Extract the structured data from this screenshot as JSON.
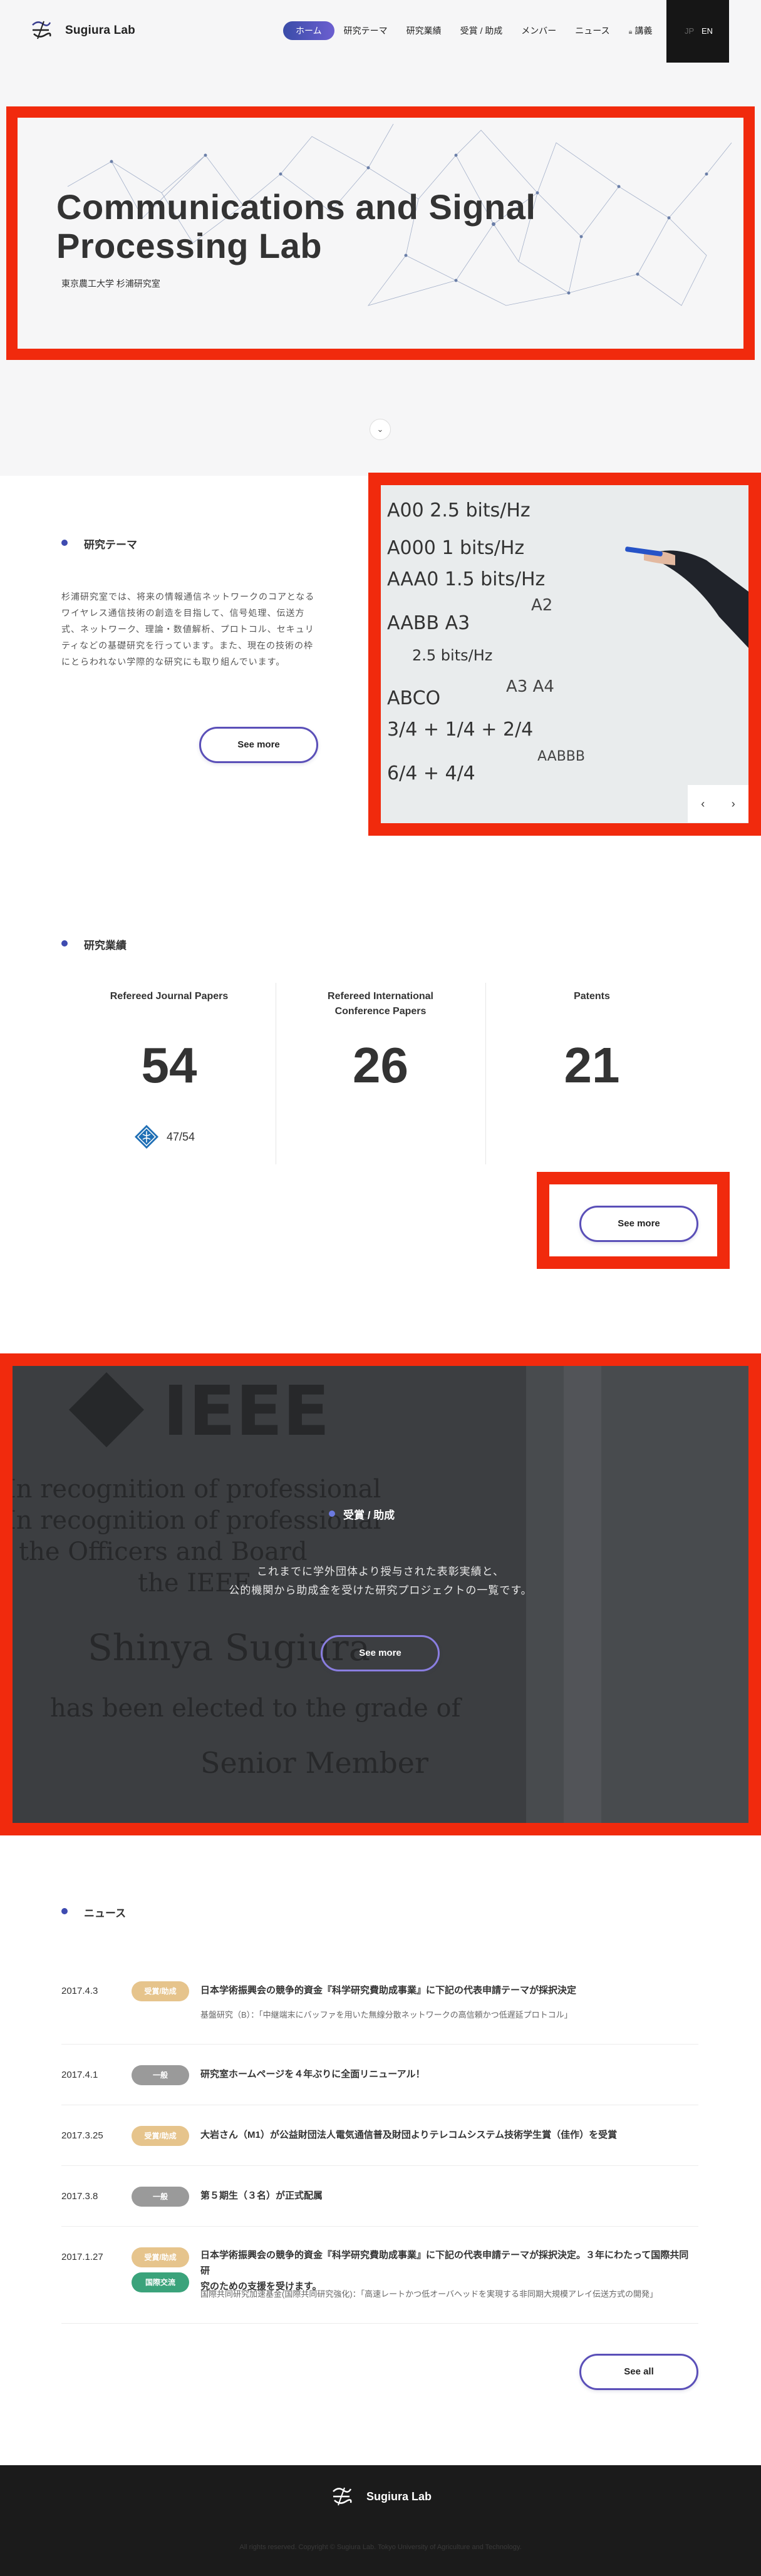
{
  "header": {
    "logo_text": "Sugiura Lab",
    "nav": [
      {
        "label": "ホーム",
        "active": true
      },
      {
        "label": "研究テーマ"
      },
      {
        "label": "研究業績"
      },
      {
        "label": "受賞 / 助成"
      },
      {
        "label": "メンバー"
      },
      {
        "label": "ニュース"
      },
      {
        "label": "講義"
      }
    ],
    "lang_jp": "JP",
    "lang_en": "EN"
  },
  "hero": {
    "title_line1": "Communications and Signal",
    "title_line2": "Processing Lab",
    "subtitle": "東京農工大学 杉浦研究室",
    "scroll_icon": "chevron-down-icon"
  },
  "research_theme": {
    "title": "研究テーマ",
    "description": "杉浦研究室では、将来の情報通信ネットワークのコアとなるワイヤレス通信技術の創造を目指して、信号処理、伝送方式、ネットワーク、理論・数値解析、プロトコル、セキュリティなどの基礎研究を行っています。また、現在の技術の枠にとらわれない学際的な研究にも取り組んでいます。",
    "more_label": "See more",
    "prev_label": "‹",
    "next_label": "›"
  },
  "achievements": {
    "title": "研究業績",
    "columns": [
      {
        "label_line1": "Refereed Journal Papers",
        "label_line2": "",
        "value": "54"
      },
      {
        "label_line1": "Refereed International",
        "label_line2": "Conference Papers",
        "value": "26"
      },
      {
        "label_line1": "Patents",
        "label_line2": "",
        "value": "21"
      }
    ],
    "ieee_ratio": "47/54",
    "more_label": "See more"
  },
  "awards": {
    "title": "受賞 / 助成",
    "desc_line1": "これまでに学外団体より授与された表彰実績と、",
    "desc_line2": "公的機関から助成金を受けた研究プロジェクトの一覧です。",
    "more_label": "See more",
    "plaque_lines": [
      "IEEE",
      "In recognition of professional",
      "In recognition of professional",
      "the Officers and Board",
      "the IEEE",
      "Shinya Sugiura",
      "has been elected to the grade of",
      "Senior Member"
    ]
  },
  "news": {
    "title": "ニュース",
    "items": [
      {
        "date": "2017.4.3",
        "badges": [
          "受賞/助成"
        ],
        "title": "日本学術振興会の競争的資金『科学研究費助成事業』に下記の代表申請テーマが採択決定",
        "title2": "",
        "sub": "基盤研究（B）：「中継端末にバッファを用いた無線分散ネットワークの高信頼かつ低遅延プロトコル」",
        "sub2": ""
      },
      {
        "date": "2017.4.1",
        "badges": [
          "一般"
        ],
        "title": "研究室ホームページを４年ぶりに全面リニューアル！",
        "title2": "",
        "sub": "",
        "sub2": ""
      },
      {
        "date": "2017.3.25",
        "badges": [
          "受賞/助成"
        ],
        "title": "大岩さん（M1）が公益財団法人電気通信普及財団よりテレコムシステム技術学生賞（佳作）を受賞",
        "title2": "",
        "sub": "",
        "sub2": ""
      },
      {
        "date": "2017.3.8",
        "badges": [
          "一般"
        ],
        "title": "第５期生（３名）が正式配属",
        "title2": "",
        "sub": "",
        "sub2": ""
      },
      {
        "date": "2017.1.27",
        "badges": [
          "受賞/助成",
          "国際交流"
        ],
        "title": "日本学術振興会の競争的資金『科学研究費助成事業』に下記の代表申請テーマが採択決定。３年にわたって国際共同研",
        "title2": "究のための支援を受けます。",
        "sub": "国際共同研究加速基金(国際共同研究強化)：「高速レートかつ低オーバヘッドを実現する非同期大規模アレイ伝送方式の開発」",
        "sub2": ""
      }
    ],
    "all_label": "See all"
  },
  "footer": {
    "name": "Sugiura Lab",
    "copyright": "All rights reserved. Copyright © Sugiura Lab. Tokyo University of Agriculture and Technology."
  },
  "colors": {
    "accent": "#3e4bb0",
    "highlight_frame": "#f12a0d",
    "badge_award": "#e6c48c",
    "badge_general": "#9a9a9a",
    "badge_intl": "#3ba37b",
    "footer_bg": "#1b1b1b"
  }
}
